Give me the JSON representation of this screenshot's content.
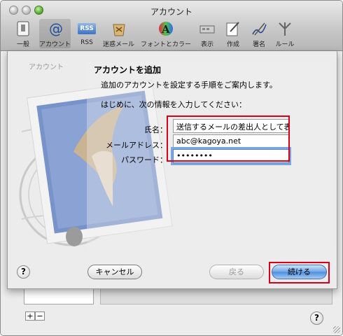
{
  "window": {
    "title": "アカウント"
  },
  "toolbar": {
    "items": [
      {
        "label": "一般",
        "icon": "switch-icon"
      },
      {
        "label": "アカウント",
        "icon": "at-sign-icon"
      },
      {
        "label": "RSS",
        "icon": "rss-icon"
      },
      {
        "label": "迷惑メール",
        "icon": "junk-mail-icon"
      },
      {
        "label": "フォントとカラー",
        "icon": "fonts-colors-icon"
      },
      {
        "label": "表示",
        "icon": "display-icon"
      },
      {
        "label": "作成",
        "icon": "compose-icon"
      },
      {
        "label": "署名",
        "icon": "signature-icon"
      },
      {
        "label": "ルール",
        "icon": "rules-icon"
      }
    ],
    "rss_icon_text": "RSS"
  },
  "background": {
    "accounts_tab": "アカウント"
  },
  "sheet": {
    "heading": "アカウントを追加",
    "description": "追加のアカウントを設定する手順をご案内します。",
    "instruction": "はじめに、次の情報を入力してください：",
    "fields": {
      "name_label": "氏名：",
      "name_value": "送信するメールの差出人として表",
      "email_label": "メールアドレス：",
      "email_value": "abc@kagoya.net",
      "password_label": "パスワード：",
      "password_value": "••••••••"
    },
    "buttons": {
      "cancel": "キャンセル",
      "back": "戻る",
      "continue": "続ける"
    },
    "help": "?"
  },
  "bottom": {
    "plus": "+",
    "minus": "−",
    "help": "?"
  },
  "colors": {
    "highlight_red": "#d9001b",
    "focus_blue": "#7aa7e0",
    "default_button": "#4c8ede"
  }
}
